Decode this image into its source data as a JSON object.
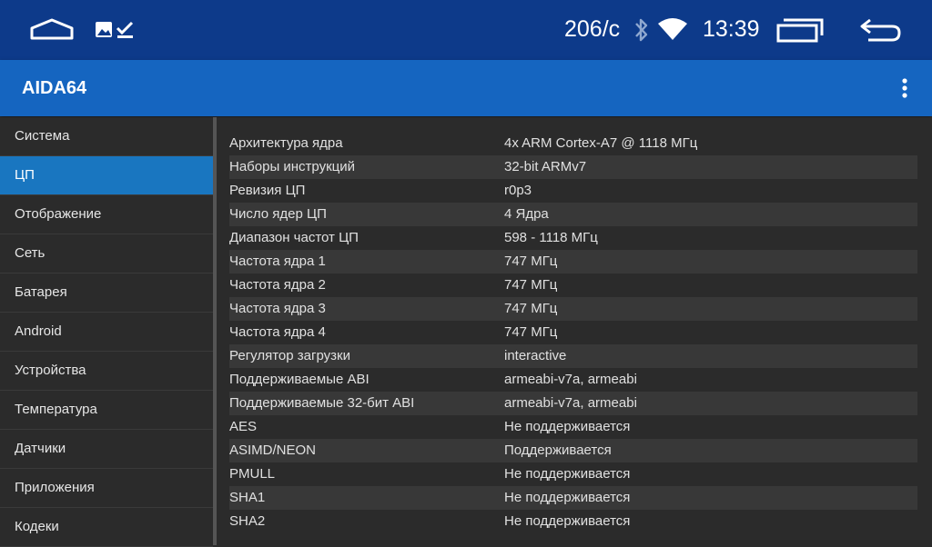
{
  "statusbar": {
    "speed": "206/с",
    "time": "13:39",
    "icons": [
      "home-icon",
      "gallery-check-icon",
      "bluetooth-icon",
      "wifi-icon",
      "recents-icon",
      "back-icon"
    ]
  },
  "appbar": {
    "title": "AIDA64"
  },
  "sidebar": {
    "items": [
      {
        "label": "Система"
      },
      {
        "label": "ЦП"
      },
      {
        "label": "Отображение"
      },
      {
        "label": "Сеть"
      },
      {
        "label": "Батарея"
      },
      {
        "label": "Android"
      },
      {
        "label": "Устройства"
      },
      {
        "label": "Температура"
      },
      {
        "label": "Датчики"
      },
      {
        "label": "Приложения"
      },
      {
        "label": "Кодеки"
      }
    ],
    "active_index": 1
  },
  "cpu": {
    "rows": [
      {
        "key": "Архитектура ядра",
        "value": "4x ARM Cortex-A7 @ 1118 МГц"
      },
      {
        "key": "Наборы инструкций",
        "value": "32-bit ARMv7"
      },
      {
        "key": "Ревизия ЦП",
        "value": "r0p3"
      },
      {
        "key": "Число ядер ЦП",
        "value": "4 Ядра"
      },
      {
        "key": "Диапазон частот ЦП",
        "value": "598 - 1118 МГц"
      },
      {
        "key": "Частота ядра 1",
        "value": "747 МГц"
      },
      {
        "key": "Частота ядра 2",
        "value": "747 МГц"
      },
      {
        "key": "Частота ядра 3",
        "value": "747 МГц"
      },
      {
        "key": "Частота ядра 4",
        "value": "747 МГц"
      },
      {
        "key": "Регулятор загрузки",
        "value": "interactive"
      },
      {
        "key": "Поддерживаемые ABI",
        "value": "armeabi-v7a, armeabi"
      },
      {
        "key": "Поддерживаемые 32-бит ABI",
        "value": "armeabi-v7a, armeabi"
      },
      {
        "key": "AES",
        "value": "Не поддерживается"
      },
      {
        "key": "ASIMD/NEON",
        "value": "Поддерживается"
      },
      {
        "key": "PMULL",
        "value": "Не поддерживается"
      },
      {
        "key": "SHA1",
        "value": "Не поддерживается"
      },
      {
        "key": "SHA2",
        "value": "Не поддерживается"
      }
    ]
  },
  "colors": {
    "statusbar": "#0d3a8a",
    "appbar": "#1565c0",
    "active_item": "#1976c0",
    "background": "#2b2b2b"
  }
}
